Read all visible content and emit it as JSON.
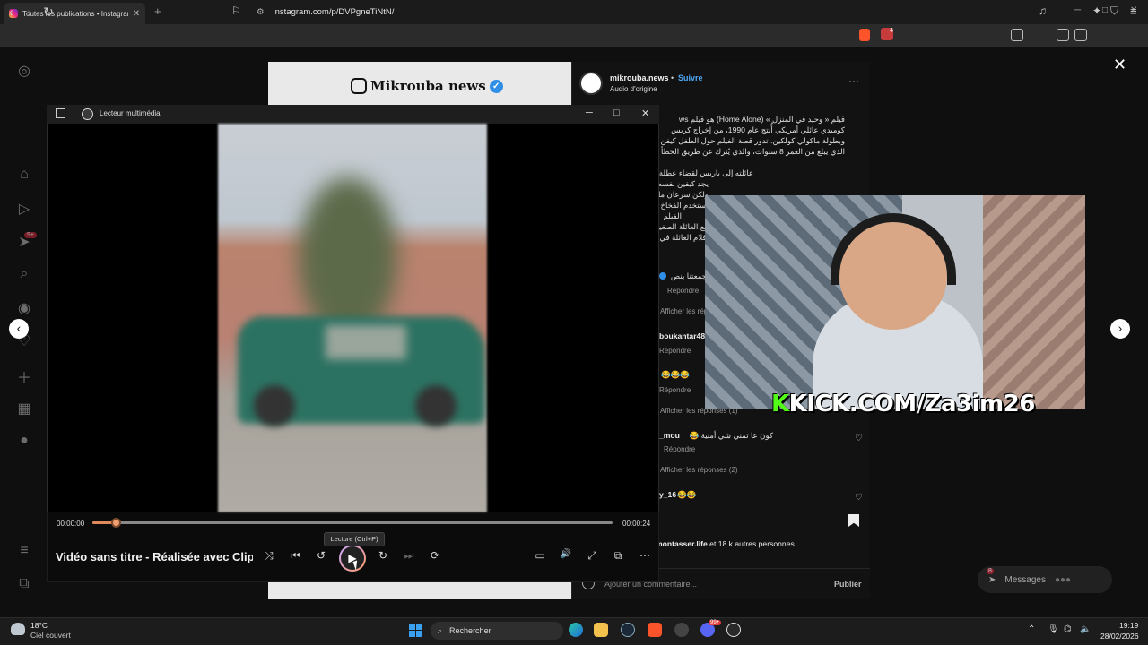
{
  "browser": {
    "tab_title": "Toutes les publications • Instagram",
    "new_tab": "+",
    "url": "instagram.com/p/DVPgneTiNtN/",
    "win_min": "─",
    "win_max": "□",
    "win_close": "✕",
    "tab_close": "✕",
    "notif_badge": "4"
  },
  "instagram": {
    "sidebar_badge": "9+",
    "post_brand": "Mikrouba news",
    "verified": "✓",
    "author": "mikrouba.news",
    "dot": "•",
    "follow": "Suivre",
    "audio": "Audio d'origine",
    "more": "⋯",
    "caption_lines": [
      "فيلم « وحيد في المنزل » (Home Alone) هو فيلم ws",
      "كوميدي عائلي أمريكي أُنتج عام 1990، من إخراج كريس",
      "وبطولة ماكولي كولكين. تدور قصة الفيلم حول الطفل كيفن",
      "الذي يبلغ من العمر 8 سنوات، والذي يُترك عن طريق الخطأ",
      "عائلته إلى باريس لقضاء عطلة",
      "يجد كيفين نفسه وحيدًا في المنزل ويستمتع بالحرية في البداية",
      "ولكن سرعان ما يضطر للدفاع عن منزله ضد لصين عند",
      "يستخدم الفخاخ الذكية والمبتكرة لحماية منزله",
      "الفيلم",
      "مع العائلة الصغيرة",
      "أفلام العائلة في"
    ],
    "comments": [
      {
        "user": "",
        "text": "جمعتنا بنص",
        "reply": "Répondre"
      },
      {
        "meta": "Afficher les réponses"
      },
      {
        "user": "boukantar48",
        "reply": "Répondre"
      },
      {
        "text": "😂😂😂",
        "reply": "Répondre"
      },
      {
        "meta": "Afficher les réponses (1)"
      },
      {
        "user": "_mou",
        "text": "كون عا تمني شي أمنية 😂",
        "reply": "Répondre"
      },
      {
        "meta": "Afficher les réponses (2)"
      },
      {
        "user": "y_16",
        "text": "😂😂"
      }
    ],
    "likes_prefix": "Aimé par ",
    "likes_user": "montasser.life",
    "likes_suffix": " et 18 k autres personnes",
    "add_comment": "Ajouter un commentaire...",
    "publish": "Publier",
    "messages": "Messages",
    "messages_badge": "8",
    "close": "✕",
    "prev": "‹",
    "next": "›"
  },
  "overlay": {
    "kick_k": "K",
    "kick_text": "KICK.COM/Za3im26"
  },
  "player": {
    "app_name": "Lecteur multimédia",
    "current_time": "00:00:00",
    "total_time": "00:00:24",
    "progress_fraction": 0.04,
    "title": "Vidéo sans titre - Réalisée avec Clipchamp",
    "tooltip": "Lecture (Ctrl+P)",
    "btn_shuffle": "⤨",
    "btn_prev": "⏮",
    "btn_back10": "↺",
    "btn_play": "▶",
    "btn_fwd30": "↻",
    "btn_next": "⏭",
    "btn_repeat": "⟳",
    "btn_subtitles": "▭",
    "btn_volume": "🔊",
    "btn_fullscreen": "⤢",
    "btn_miniplayer": "⧉",
    "btn_more": "⋯"
  },
  "taskbar": {
    "temperature": "18°C",
    "weather": "Ciel couvert",
    "search": "Rechercher",
    "time": "19:19",
    "date": "28/02/2026",
    "discord_badge": "99+"
  }
}
